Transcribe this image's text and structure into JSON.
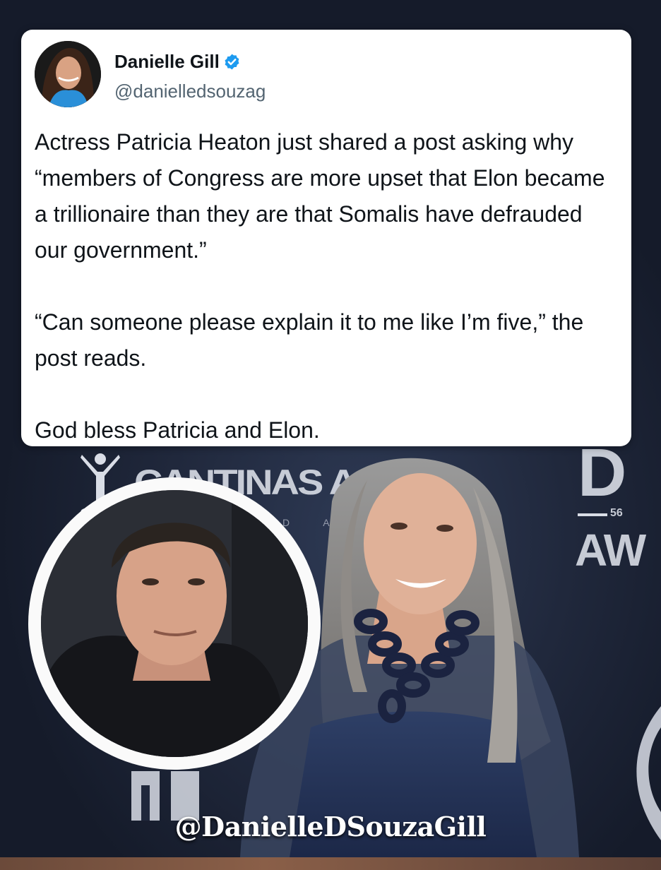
{
  "tweet": {
    "display_name": "Danielle Gill",
    "handle": "@danielledsouzag",
    "verified": true,
    "verified_icon": "verified-badge-icon",
    "body_paragraphs": [
      "Actress Patricia Heaton just shared a post asking why “members of Congress are more upset that Elon became a trillionaire than they are that Somalis have defrauded our government.”",
      "“Can someone please explain it to me like I’m five,” the post reads.",
      "God bless Patricia and Elon."
    ]
  },
  "backdrop": {
    "cantinas_text": "CANTINAS A",
    "dated_text": "D A T",
    "corner_text": "D",
    "number_text": "56",
    "award_text": "AW"
  },
  "watermark": "@DanielleDSouzaGill",
  "colors": {
    "verified_blue": "#1d9bf0",
    "card_bg": "#ffffff",
    "background": "#20283c"
  }
}
